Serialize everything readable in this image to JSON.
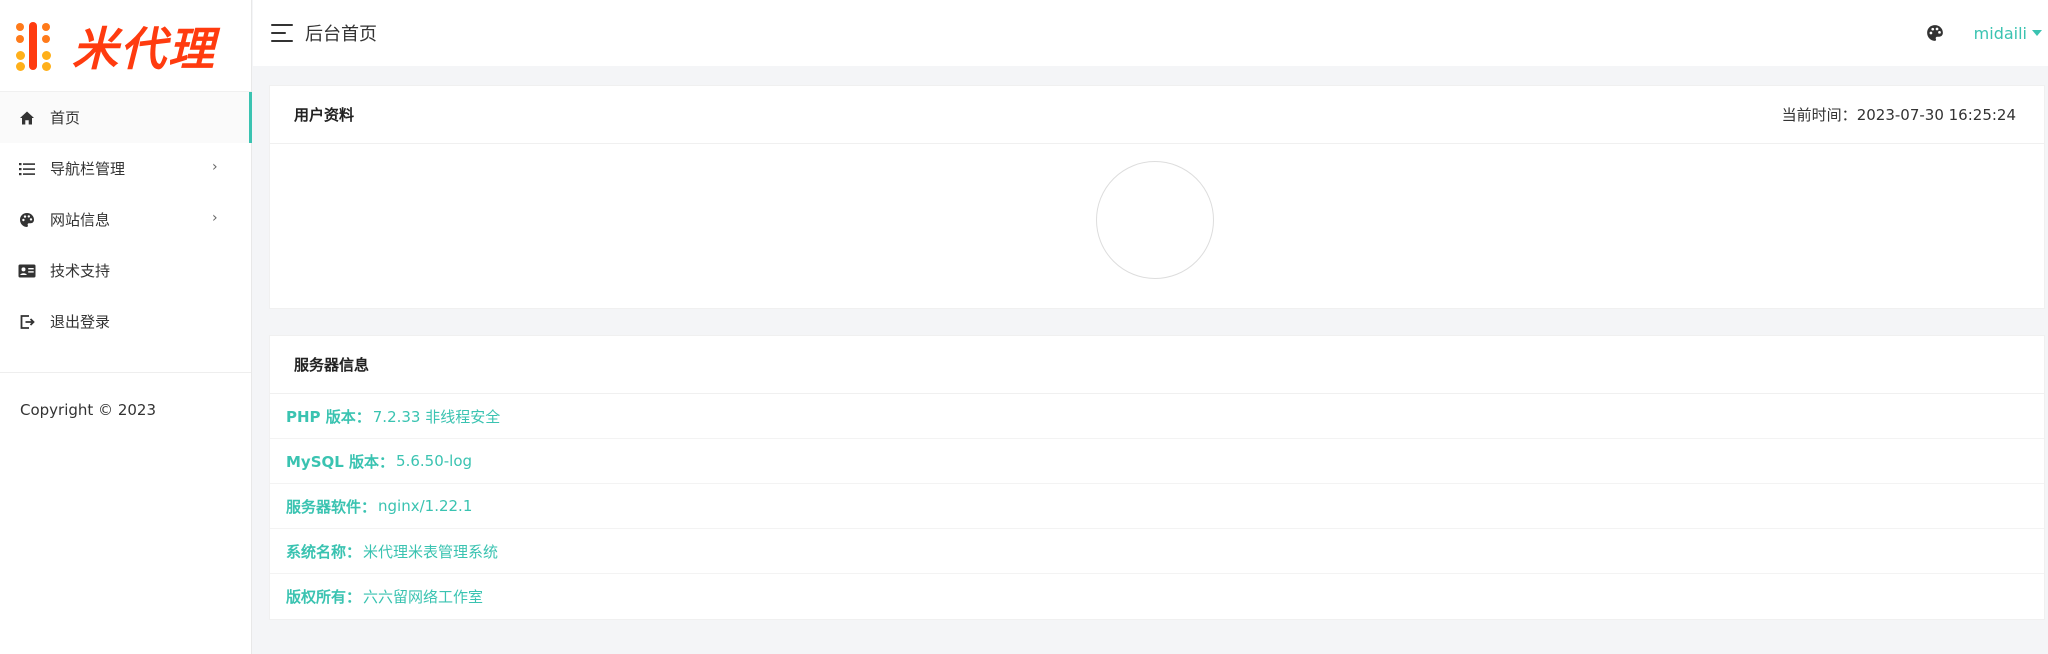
{
  "brand": {
    "logo_text": "米代理",
    "accent_color": "#3ac3b1",
    "logo_color": "#ff3b0f"
  },
  "sidebar": {
    "items": [
      {
        "label": "首页",
        "icon": "home-icon",
        "active": true,
        "has_submenu": false
      },
      {
        "label": "导航栏管理",
        "icon": "list-icon",
        "active": false,
        "has_submenu": true
      },
      {
        "label": "网站信息",
        "icon": "palette-icon",
        "active": false,
        "has_submenu": true
      },
      {
        "label": "技术支持",
        "icon": "id-card-icon",
        "active": false,
        "has_submenu": false
      },
      {
        "label": "退出登录",
        "icon": "logout-icon",
        "active": false,
        "has_submenu": false
      }
    ],
    "submenu_arrow": "›",
    "copyright": "Copyright © 2023"
  },
  "header": {
    "title": "后台首页",
    "username": "midaili"
  },
  "profile_card": {
    "title": "用户资料",
    "time_label": "当前时间：",
    "time_value": "2023-07-30 16:25:24"
  },
  "server_card": {
    "title": "服务器信息",
    "rows": [
      {
        "label": "PHP 版本：",
        "value": "7.2.33 非线程安全"
      },
      {
        "label": "MySQL 版本：",
        "value": "5.6.50-log"
      },
      {
        "label": "服务器软件：",
        "value": "nginx/1.22.1"
      },
      {
        "label": "系统名称：",
        "value": "米代理米表管理系统"
      },
      {
        "label": "版权所有：",
        "value": "六六留网络工作室"
      }
    ]
  }
}
